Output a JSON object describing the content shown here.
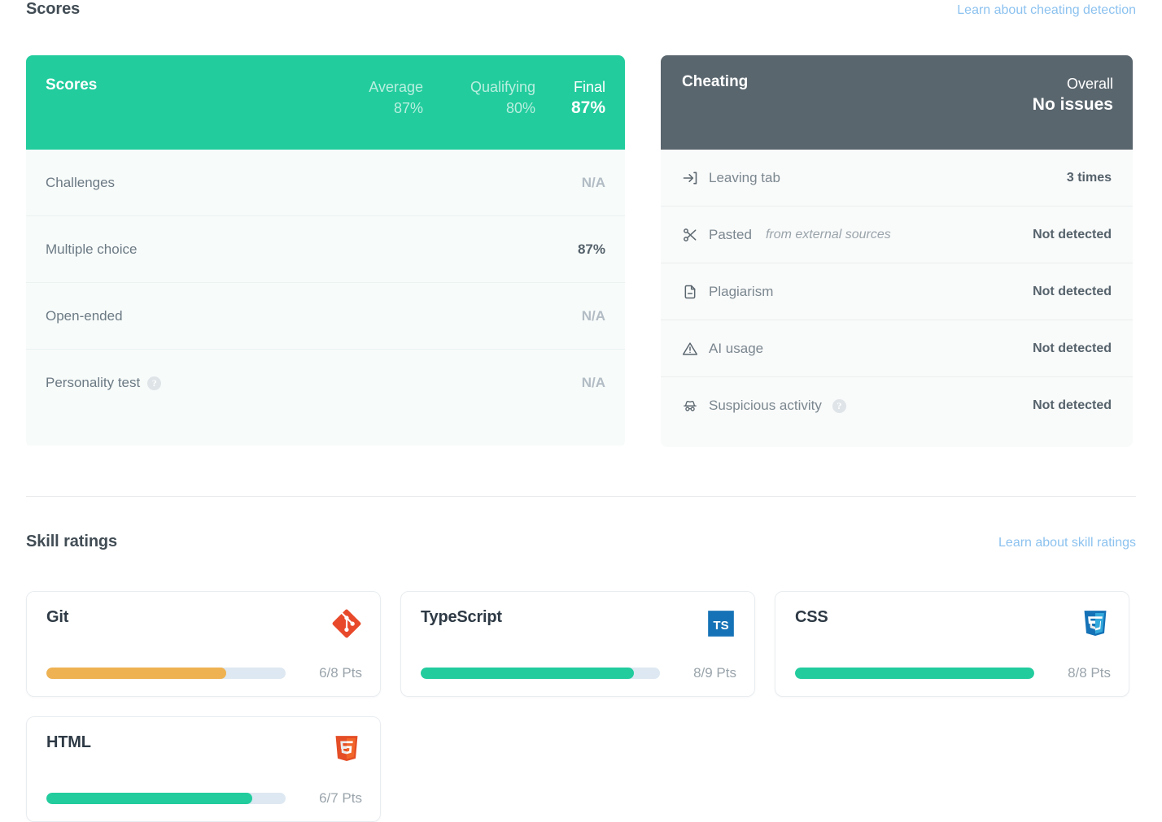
{
  "scores_section": {
    "title": "Scores",
    "learn_link": "Learn about cheating detection",
    "panel": {
      "header_label": "Scores",
      "columns": [
        {
          "name": "Average",
          "value": "87%"
        },
        {
          "name": "Qualifying",
          "value": "80%"
        },
        {
          "name": "Final",
          "value": "87%"
        }
      ],
      "rows": [
        {
          "label": "Challenges",
          "value": "N/A",
          "has_score": false,
          "help": false
        },
        {
          "label": "Multiple choice",
          "value": "87%",
          "has_score": true,
          "help": false
        },
        {
          "label": "Open-ended",
          "value": "N/A",
          "has_score": false,
          "help": false
        },
        {
          "label": "Personality test",
          "value": "N/A",
          "has_score": false,
          "help": true
        }
      ]
    }
  },
  "cheating": {
    "header_label": "Cheating",
    "overall_label": "Overall",
    "overall_value": "No issues",
    "rows": [
      {
        "icon": "leave-tab-icon",
        "label": "Leaving tab",
        "note": "",
        "value": "3 times",
        "help": false
      },
      {
        "icon": "scissors-icon",
        "label": "Pasted",
        "note": "from external sources",
        "value": "Not detected",
        "help": false
      },
      {
        "icon": "document-minus-icon",
        "label": "Plagiarism",
        "note": "",
        "value": "Not detected",
        "help": false
      },
      {
        "icon": "warning-triangle-icon",
        "label": "AI usage",
        "note": "",
        "value": "Not detected",
        "help": false
      },
      {
        "icon": "incognito-hat-icon",
        "label": "Suspicious activity",
        "note": "",
        "value": "Not detected",
        "help": true
      }
    ]
  },
  "skills_section": {
    "title": "Skill ratings",
    "learn_link": "Learn about skill ratings",
    "cards": [
      {
        "name": "Git",
        "logo": "git-logo-icon",
        "points_label": "6/8 Pts",
        "earned": 6,
        "total": 8,
        "percent": 75,
        "bar_color": "#eeb252"
      },
      {
        "name": "TypeScript",
        "logo": "typescript-logo-icon",
        "points_label": "8/9 Pts",
        "earned": 8,
        "total": 9,
        "percent": 89,
        "bar_color": "#22cc9d"
      },
      {
        "name": "CSS",
        "logo": "css3-logo-icon",
        "points_label": "8/8 Pts",
        "earned": 8,
        "total": 8,
        "percent": 100,
        "bar_color": "#22cc9d"
      },
      {
        "name": "HTML",
        "logo": "html5-logo-icon",
        "points_label": "6/7 Pts",
        "earned": 6,
        "total": 7,
        "percent": 86,
        "bar_color": "#22cc9d"
      }
    ]
  },
  "colors": {
    "scores_header_bg": "#22cc9d",
    "cheating_header_bg": "#5a666e",
    "link_blue": "#8cc2ef",
    "bar_green": "#22cc9d",
    "bar_amber": "#eeb252",
    "bar_track": "#dde8f2"
  }
}
